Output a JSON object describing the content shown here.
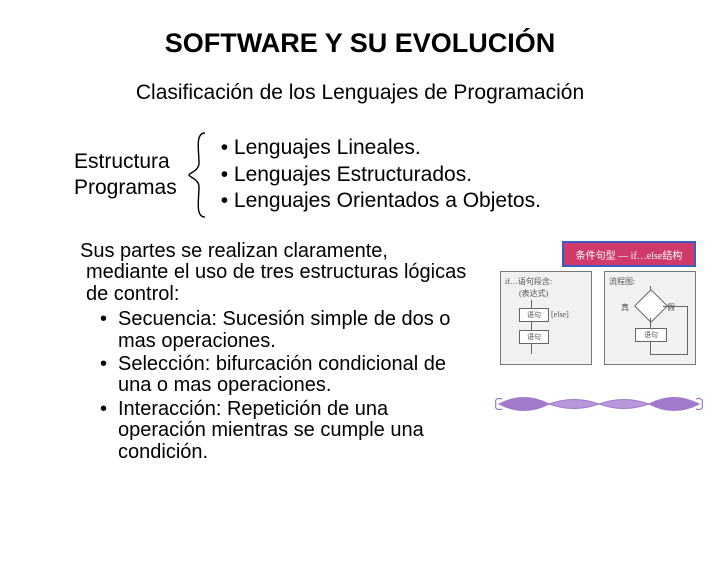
{
  "title": "SOFTWARE Y SU EVOLUCIÓN",
  "subtitle": "Clasificación de los Lenguajes de Programación",
  "brace": {
    "label_line1": "Estructura",
    "label_line2": "Programas",
    "items": [
      "• Lenguajes Lineales.",
      "• Lenguajes Estructurados.",
      "• Lenguajes Orientados a Objetos."
    ]
  },
  "body": {
    "intro": "Sus partes se realizan claramente, mediante el uso de tres estructuras lógicas de control:",
    "points": [
      "Secuencia: Sucesión simple de dos o mas operaciones.",
      "Selección: bifurcación condicional de una o mas operaciones.",
      "Interacción: Repetición de una operación mientras se cumple una condición."
    ]
  },
  "figure": {
    "caption_cn": "条件句型 — if…else结构",
    "box1": {
      "header": "if…语句段含:",
      "sub": "(表达式)",
      "step_a": "语句",
      "arrow_a": "[else]",
      "step_b": "语句",
      "arrow_b": "↓"
    },
    "box2": {
      "header": "流程图:",
      "true": "真",
      "false": "假",
      "step": "语句"
    }
  }
}
